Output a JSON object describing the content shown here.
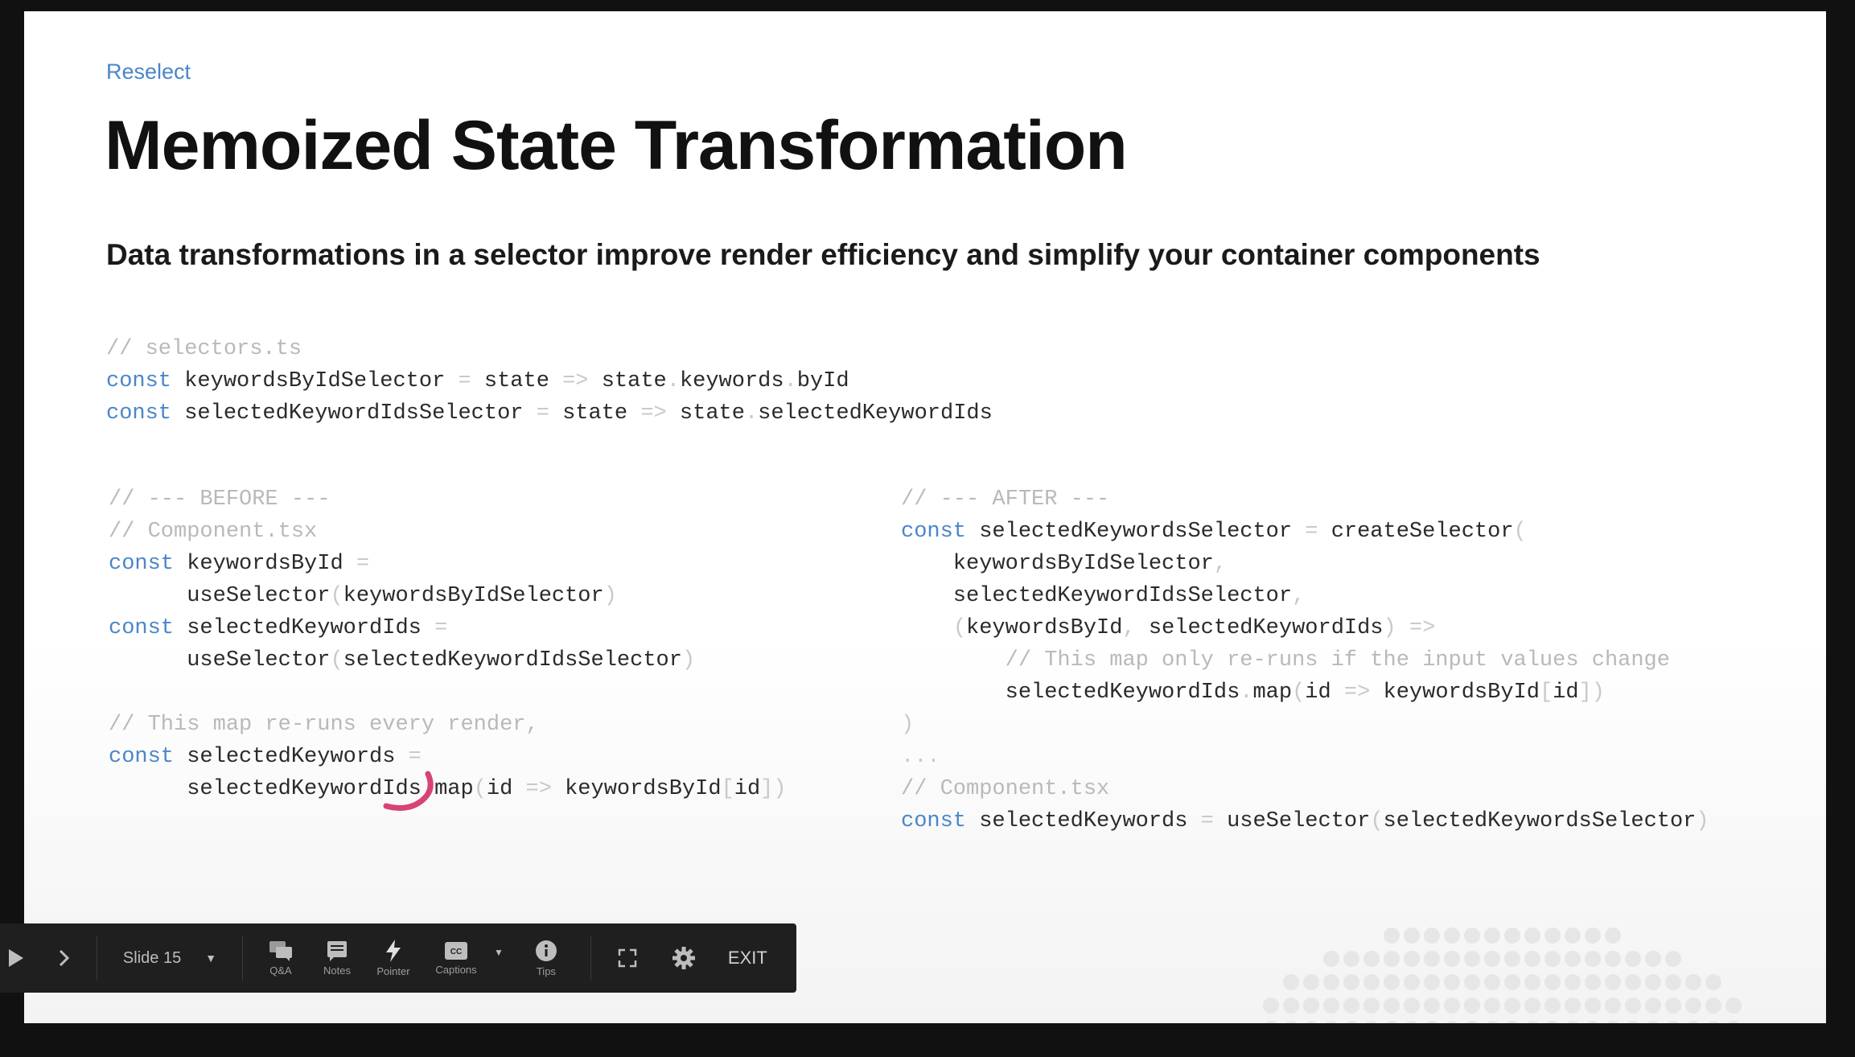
{
  "slide": {
    "kicker": "Reselect",
    "title": "Memoized State Transformation",
    "subtitle": "Data transformations in a selector improve render efficiency and simplify your container components"
  },
  "code_top": [
    [
      {
        "t": "// selectors.ts",
        "c": "cm"
      }
    ],
    [
      {
        "t": "const",
        "c": "kw"
      },
      {
        "t": " keywordsByIdSelector "
      },
      {
        "t": "=",
        "c": "op"
      },
      {
        "t": " state "
      },
      {
        "t": "=>",
        "c": "op"
      },
      {
        "t": " state"
      },
      {
        "t": ".",
        "c": "op"
      },
      {
        "t": "keywords"
      },
      {
        "t": ".",
        "c": "op"
      },
      {
        "t": "byId"
      }
    ],
    [
      {
        "t": "const",
        "c": "kw"
      },
      {
        "t": " selectedKeywordIdsSelector "
      },
      {
        "t": "=",
        "c": "op"
      },
      {
        "t": " state "
      },
      {
        "t": "=>",
        "c": "op"
      },
      {
        "t": " state"
      },
      {
        "t": ".",
        "c": "op"
      },
      {
        "t": "selectedKeywordIds"
      }
    ]
  ],
  "code_before": [
    [
      {
        "t": "// --- BEFORE ---",
        "c": "cm"
      }
    ],
    [
      {
        "t": "// Component.tsx",
        "c": "cm"
      }
    ],
    [
      {
        "t": "const",
        "c": "kw"
      },
      {
        "t": " keywordsById "
      },
      {
        "t": "=",
        "c": "op"
      }
    ],
    [
      {
        "t": "      useSelector"
      },
      {
        "t": "(",
        "c": "op"
      },
      {
        "t": "keywordsByIdSelector"
      },
      {
        "t": ")",
        "c": "op"
      }
    ],
    [
      {
        "t": "const",
        "c": "kw"
      },
      {
        "t": " selectedKeywordIds "
      },
      {
        "t": "=",
        "c": "op"
      }
    ],
    [
      {
        "t": "      useSelector"
      },
      {
        "t": "(",
        "c": "op"
      },
      {
        "t": "selectedKeywordIdsSelector"
      },
      {
        "t": ")",
        "c": "op"
      }
    ],
    [],
    [
      {
        "t": "// This map re-runs every render,",
        "c": "cm"
      }
    ],
    [
      {
        "t": "const",
        "c": "kw"
      },
      {
        "t": " selectedKeywords "
      },
      {
        "t": "=",
        "c": "op"
      }
    ],
    [
      {
        "t": "      selectedKeywordIds"
      },
      {
        "t": ".",
        "c": "op"
      },
      {
        "t": "map"
      },
      {
        "t": "(",
        "c": "op"
      },
      {
        "t": "id "
      },
      {
        "t": "=>",
        "c": "op"
      },
      {
        "t": " keywordsById"
      },
      {
        "t": "[",
        "c": "op"
      },
      {
        "t": "id"
      },
      {
        "t": "])",
        "c": "op"
      }
    ]
  ],
  "code_after": [
    [
      {
        "t": "// --- AFTER ---",
        "c": "cm"
      }
    ],
    [
      {
        "t": "const",
        "c": "kw"
      },
      {
        "t": " selectedKeywordsSelector "
      },
      {
        "t": "=",
        "c": "op"
      },
      {
        "t": " createSelector"
      },
      {
        "t": "(",
        "c": "op"
      }
    ],
    [
      {
        "t": "    keywordsByIdSelector"
      },
      {
        "t": ",",
        "c": "op"
      }
    ],
    [
      {
        "t": "    selectedKeywordIdsSelector"
      },
      {
        "t": ",",
        "c": "op"
      }
    ],
    [
      {
        "t": "    ",
        "c": "op"
      },
      {
        "t": "(",
        "c": "op"
      },
      {
        "t": "keywordsById"
      },
      {
        "t": ",",
        "c": "op"
      },
      {
        "t": " selectedKeywordIds"
      },
      {
        "t": ")",
        "c": "op"
      },
      {
        "t": " =>",
        "c": "op"
      }
    ],
    [
      {
        "t": "        // This map only re-runs if the input values change",
        "c": "cm"
      }
    ],
    [
      {
        "t": "        selectedKeywordIds"
      },
      {
        "t": ".",
        "c": "op"
      },
      {
        "t": "map"
      },
      {
        "t": "(",
        "c": "op"
      },
      {
        "t": "id "
      },
      {
        "t": "=>",
        "c": "op"
      },
      {
        "t": " keywordsById"
      },
      {
        "t": "[",
        "c": "op"
      },
      {
        "t": "id"
      },
      {
        "t": "])",
        "c": "op"
      }
    ],
    [
      {
        "t": ")",
        "c": "op"
      }
    ],
    [
      {
        "t": "...",
        "c": "op"
      }
    ],
    [
      {
        "t": "// Component.tsx",
        "c": "cm"
      }
    ],
    [
      {
        "t": "const",
        "c": "kw"
      },
      {
        "t": " selectedKeywords "
      },
      {
        "t": "=",
        "c": "op"
      },
      {
        "t": " useSelector"
      },
      {
        "t": "(",
        "c": "op"
      },
      {
        "t": "selectedKeywordsSelector"
      },
      {
        "t": ")",
        "c": "op"
      }
    ]
  ],
  "toolbar": {
    "slide_label": "Slide 15",
    "qa_label": "Q&A",
    "notes_label": "Notes",
    "pointer_label": "Pointer",
    "captions_label": "Captions",
    "tips_label": "Tips",
    "exit_label": "EXIT"
  },
  "colors": {
    "keyword": "#4a86c8",
    "comment": "#b9b9b9",
    "pointer_scribble": "#d0215f",
    "toolbar_bg": "#1f1f1f"
  }
}
